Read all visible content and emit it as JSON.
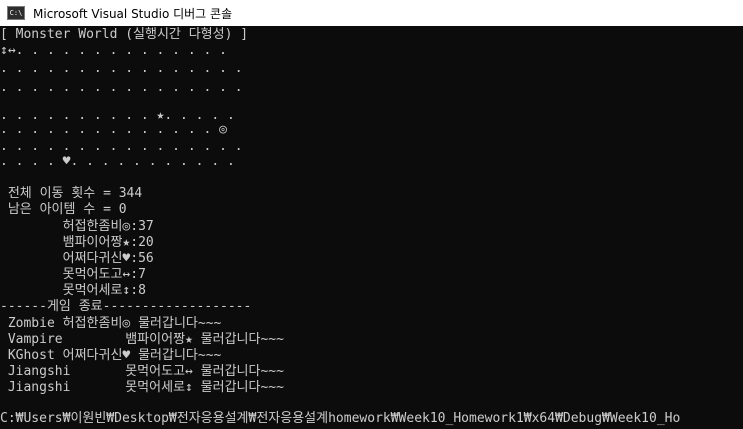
{
  "window": {
    "title": "Microsoft Visual Studio 디버그 콘솔",
    "icon_text": "C:\\"
  },
  "console": {
    "lines": [
      "[ Monster World (실행시간 다형성) ]",
      "↕↔. . . . . . . . . . . . . .",
      ". . . . . . . . . . . . . . . .",
      ". . . . . . . . . . . . . . . .",
      ". . . . . . . . . . ★. . . . .",
      ". . . . . . . . . . . . . . ◎",
      ". . . . . . . . . . . . . . . .",
      ". . . . ♥. . . . . . . . . . .",
      "",
      " 전체 이동 횟수 = 344",
      " 남은 아이템 수 = 0",
      "        허접한좀비◎:37",
      "        뱀파이어짱★:20",
      "        어쩌다귀신♥:56",
      "        못먹어도고↔:7",
      "        못먹어세로↕:8",
      "------게임 종료-------------------",
      " Zombie 허접한좀비◎ 물러갑니다~~~",
      " Vampire        뱀파이어짱★ 물러갑니다~~~",
      " KGhost 어쩌다귀신♥ 물러갑니다~~~",
      " Jiangshi       못먹어도고↔ 물러갑니다~~~",
      " Jiangshi       못먹어세로↕ 물러갑니다~~~",
      "",
      "C:₩Users₩이원빈₩Desktop₩전자응용설계₩전자응용설계homework₩Week10_Homework1₩x64₩Debug₩Week10_Ho"
    ]
  }
}
